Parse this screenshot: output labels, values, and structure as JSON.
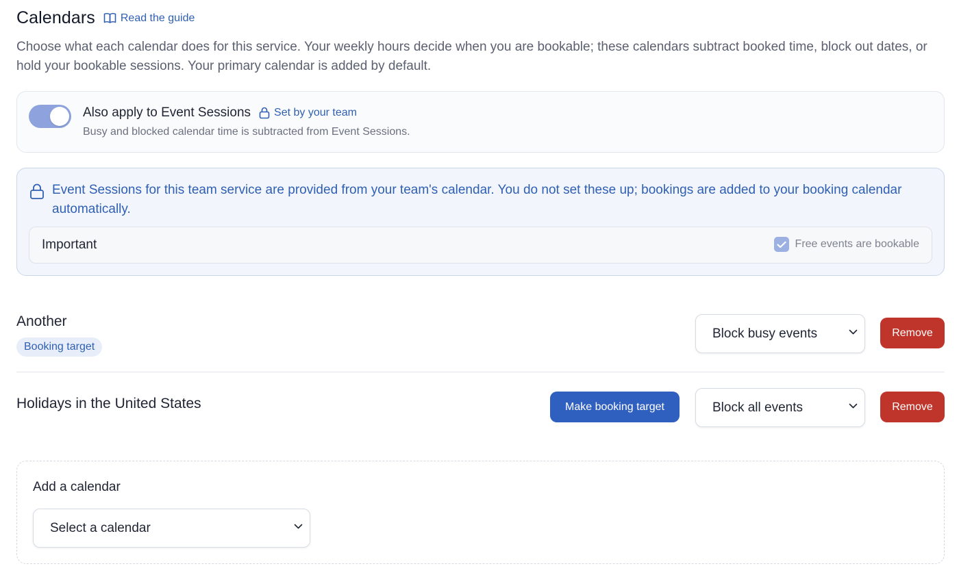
{
  "header": {
    "title": "Calendars",
    "guide_link": "Read the guide"
  },
  "intro": "Choose what each calendar does for this service. Your weekly hours decide when you are bookable; these calendars subtract booked time, block out dates, or hold your bookable sessions. Your primary calendar is added by default.",
  "apply_card": {
    "toggle_on": true,
    "label": "Also apply to Event Sessions",
    "team_note": "Set by your team",
    "description": "Busy and blocked calendar time is subtracted from Event Sessions."
  },
  "info_card": {
    "message": "Event Sessions for this team service are provided from your team's calendar. You do not set these up; bookings are added to your booking calendar automatically.",
    "important_label": "Important",
    "free_events_label": "Free events are bookable",
    "free_events_checked": true
  },
  "calendars": [
    {
      "name": "Another",
      "badge": "Booking target",
      "mode": "Block busy events",
      "remove_label": "Remove"
    },
    {
      "name": "Holidays in the United States",
      "make_target_label": "Make booking target",
      "mode": "Block all events",
      "remove_label": "Remove"
    }
  ],
  "add_calendar": {
    "label": "Add a calendar",
    "select_placeholder": "Select a calendar"
  },
  "colors": {
    "accent": "#2f5fb3",
    "primary_button": "#2f5fbf",
    "danger": "#c0352b",
    "toggle_on": "#8ea3de",
    "info_bg": "#f2f6fc"
  }
}
